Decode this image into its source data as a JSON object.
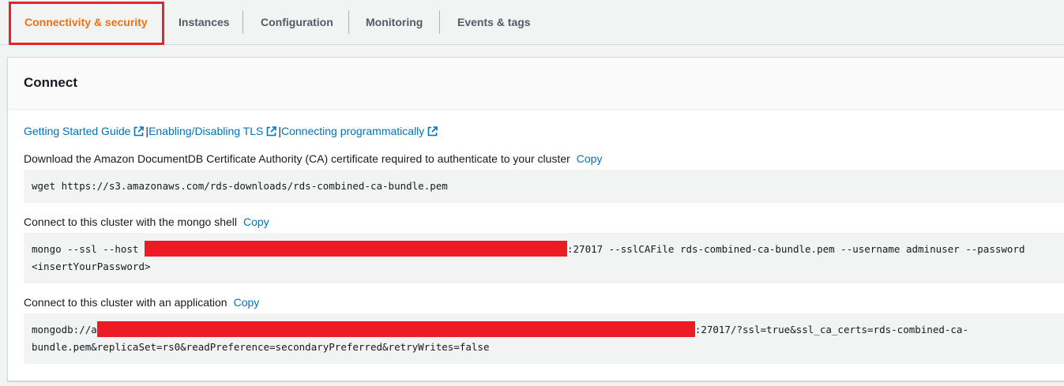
{
  "tabs": [
    {
      "label": "Connectivity & security",
      "active": true
    },
    {
      "label": "Instances"
    },
    {
      "label": "Configuration"
    },
    {
      "label": "Monitoring"
    },
    {
      "label": "Events & tags"
    }
  ],
  "panel": {
    "title": "Connect",
    "links": [
      {
        "label": "Getting Started Guide"
      },
      {
        "label": "Enabling/Disabling TLS"
      },
      {
        "label": "Connecting programmatically"
      }
    ],
    "link_separator": "|",
    "ca_cert": {
      "label": "Download the Amazon DocumentDB Certificate Authority (CA) certificate required to authenticate to your cluster",
      "copy": "Copy",
      "command": "wget https://s3.amazonaws.com/rds-downloads/rds-combined-ca-bundle.pem"
    },
    "mongo_shell": {
      "label": "Connect to this cluster with the mongo shell",
      "copy": "Copy",
      "cmd_prefix": "mongo --ssl --host ",
      "cmd_suffix": ":27017 --sslCAFile rds-combined-ca-bundle.pem --username adminuser --password",
      "cmd_line2": "<insertYourPassword>"
    },
    "application": {
      "label": "Connect to this cluster with an application",
      "copy": "Copy",
      "uri_prefix": "mongodb://a",
      "uri_suffix": ":27017/?ssl=true&ssl_ca_certs=rds-combined-ca-",
      "uri_line2": "bundle.pem&replicaSet=rs0&readPreference=secondaryPreferred&retryWrites=false"
    }
  },
  "colors": {
    "active_tab": "#ec7211",
    "link": "#0073bb",
    "highlight_box": "#e0262b",
    "redaction": "#ed1c24"
  }
}
